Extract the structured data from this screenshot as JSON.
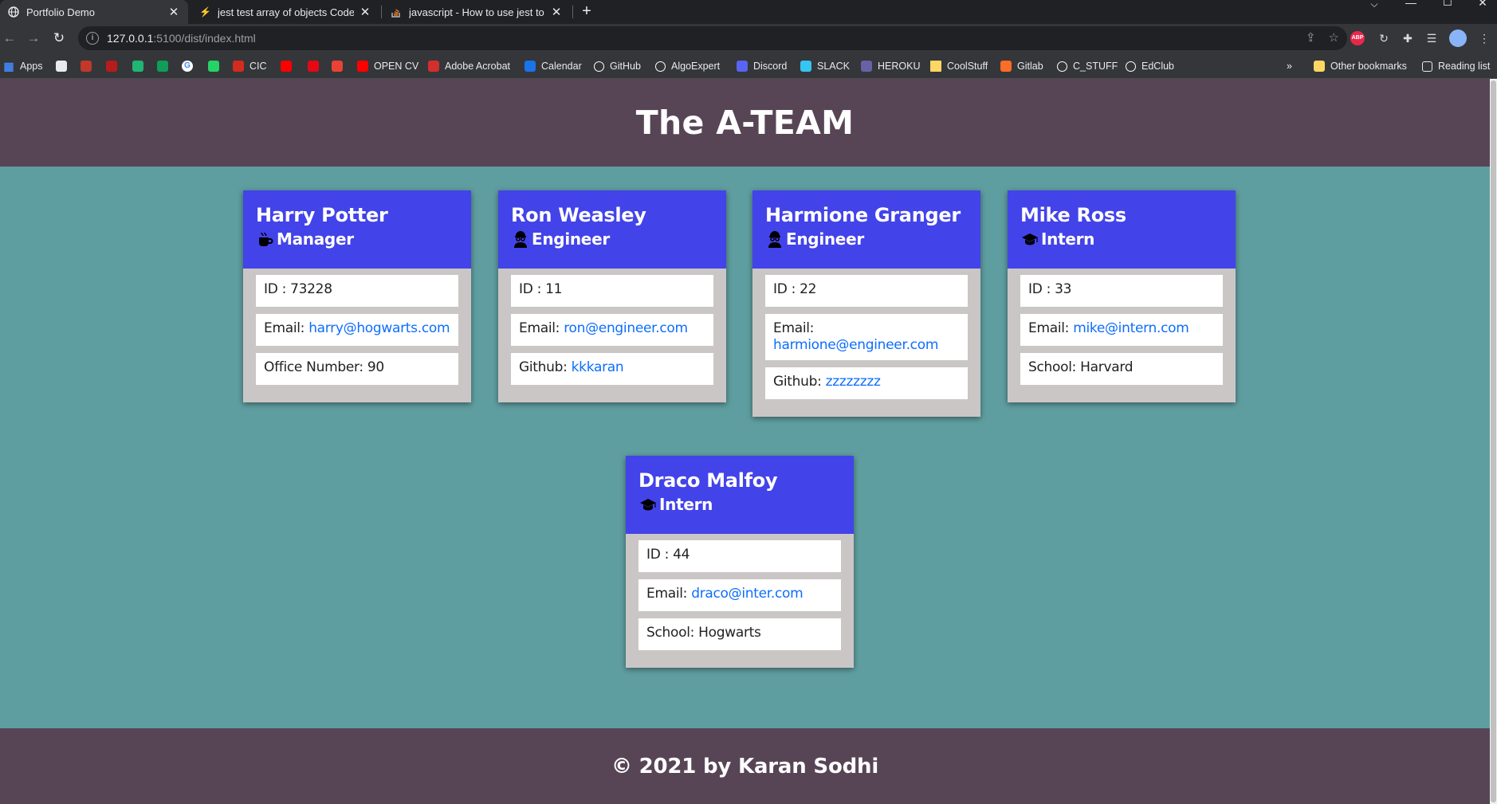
{
  "browser": {
    "tabs": [
      {
        "title": "Portfolio Demo",
        "favicon": "globe-icon",
        "active": true
      },
      {
        "title": "jest test array of objects Code Ex",
        "favicon": "grepper-icon",
        "active": false
      },
      {
        "title": "javascript - How to use jest to te",
        "favicon": "stackoverflow-icon",
        "active": false
      }
    ],
    "new_tab": "+",
    "url_host": "127.0.0.1",
    "url_rest": ":5100/dist/index.html",
    "bookmarks": [
      {
        "label": "Apps",
        "icon": "apps-grid-icon",
        "color": "#4285f4"
      },
      {
        "label": "",
        "icon": "circle-icon",
        "color": "#e8eaed"
      },
      {
        "label": "",
        "icon": "la-icon",
        "color": "#c0392b"
      },
      {
        "label": "",
        "icon": "nyt-icon",
        "color": "#b71c1c"
      },
      {
        "label": "",
        "icon": "u-icon",
        "color": "#21b573"
      },
      {
        "label": "",
        "icon": "w-icon",
        "color": "#0f9d58"
      },
      {
        "label": "",
        "icon": "google-icon",
        "color": "#ffffff"
      },
      {
        "label": "",
        "icon": "whatsapp-icon",
        "color": "#25d366"
      },
      {
        "label": "CIC",
        "icon": "maple-leaf-icon",
        "color": "#d52b1e"
      },
      {
        "label": "",
        "icon": "youtube-icon",
        "color": "#ff0000"
      },
      {
        "label": "",
        "icon": "netflix-icon",
        "color": "#e50914"
      },
      {
        "label": "",
        "icon": "gmail-icon",
        "color": "#ea4335"
      },
      {
        "label": "OPEN CV",
        "icon": "youtube-icon",
        "color": "#ff0000"
      },
      {
        "label": "Adobe Acrobat",
        "icon": "acrobat-icon",
        "color": "#d32f2f"
      },
      {
        "label": "Calendar",
        "icon": "calendar-icon",
        "color": "#1a73e8"
      },
      {
        "label": "GitHub",
        "icon": "github-icon",
        "color": "#ffffff"
      },
      {
        "label": "AlgoExpert",
        "icon": "algoexpert-icon",
        "color": "#ffffff"
      },
      {
        "label": "Discord",
        "icon": "discord-icon",
        "color": "#5865f2"
      },
      {
        "label": "SLACK",
        "icon": "slack-icon",
        "color": "#36c5f0"
      },
      {
        "label": "HEROKU",
        "icon": "heroku-icon",
        "color": "#6762a6"
      },
      {
        "label": "CoolStuff",
        "icon": "folder-icon",
        "color": "#fdd663"
      },
      {
        "label": "Gitlab",
        "icon": "gitlab-icon",
        "color": "#fc6d26"
      },
      {
        "label": "C_STUFF",
        "icon": "c-stuff-icon",
        "color": "#ffffff"
      },
      {
        "label": "EdClub",
        "icon": "edclub-icon",
        "color": "#ffffff"
      }
    ],
    "more_bookmarks": "»",
    "other_bookmarks": "Other bookmarks",
    "reading_list": "Reading list"
  },
  "page": {
    "title": "The A-TEAM",
    "footer": "© 2021 by Karan Sodhi",
    "colors": {
      "header_bg": "#574556",
      "body_bg": "#5f9ea0",
      "card_header": "#4343ea",
      "card_body": "#cbc6c6",
      "link": "#0d6efd"
    }
  },
  "team": [
    {
      "name": "Harry Potter",
      "role": "Manager",
      "role_icon": "coffee-mug-icon",
      "id_label": "ID : 73228",
      "email_label": "Email: ",
      "email": "harry@hogwarts.com",
      "extra_label": "Office Number: 90",
      "extra_link": ""
    },
    {
      "name": "Ron Weasley",
      "role": "Engineer",
      "role_icon": "engineer-glasses-icon",
      "id_label": "ID : 11",
      "email_label": "Email: ",
      "email": "ron@engineer.com",
      "extra_label": "Github: ",
      "extra_link": "kkkaran"
    },
    {
      "name": "Harmione Granger",
      "role": "Engineer",
      "role_icon": "engineer-glasses-icon",
      "id_label": "ID : 22",
      "email_label": "Email: ",
      "email": "harmione@engineer.com",
      "extra_label": "Github: ",
      "extra_link": "zzzzzzzz"
    },
    {
      "name": "Mike Ross",
      "role": "Intern",
      "role_icon": "graduation-cap-icon",
      "id_label": "ID : 33",
      "email_label": "Email: ",
      "email": "mike@intern.com",
      "extra_label": "School: Harvard",
      "extra_link": ""
    },
    {
      "name": "Draco Malfoy",
      "role": "Intern",
      "role_icon": "graduation-cap-icon",
      "id_label": "ID : 44",
      "email_label": "Email: ",
      "email": "draco@inter.com",
      "extra_label": "School: Hogwarts",
      "extra_link": ""
    }
  ]
}
